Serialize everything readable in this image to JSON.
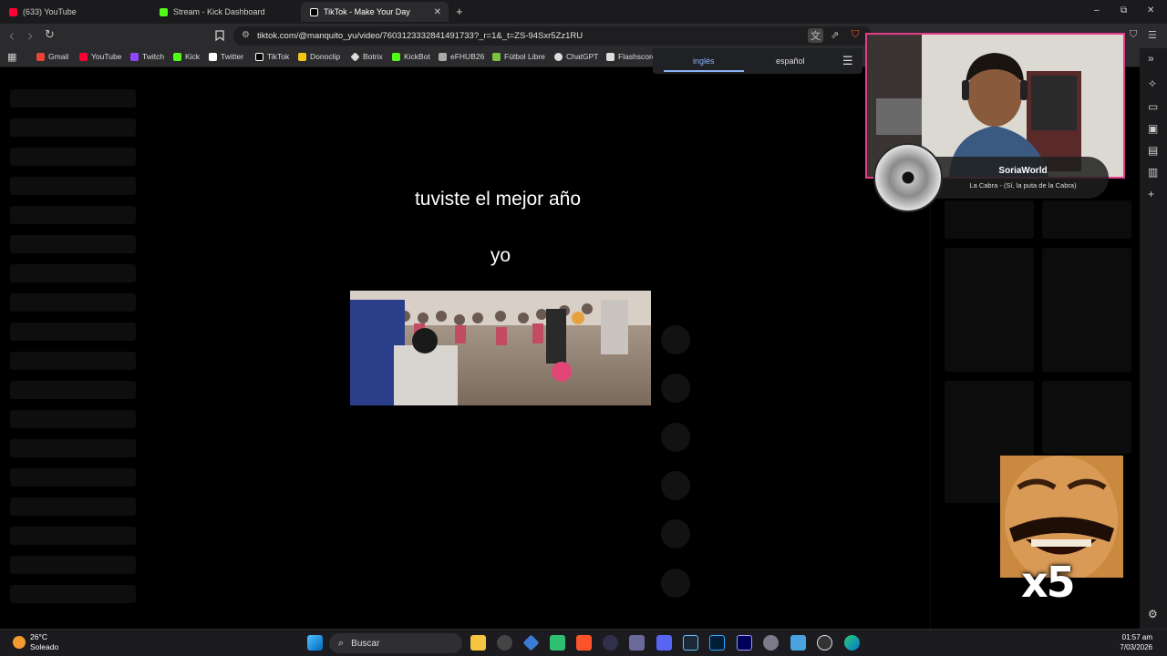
{
  "tabs": [
    {
      "title": "(633) YouTube",
      "color": "#ff0033",
      "active": false
    },
    {
      "title": "Stream - Kick Dashboard",
      "color": "#53fc18",
      "active": false
    },
    {
      "title": "TikTok - Make Your Day",
      "color": "#ffffff",
      "active": true
    }
  ],
  "tab_close": "✕",
  "new_tab": "+",
  "window_controls": {
    "minimize": "–",
    "restore": "⧉",
    "close": "✕"
  },
  "nav": {
    "back": "‹",
    "forward": "›",
    "reload": "↻",
    "bookmark_icon": "bookmark-icon"
  },
  "url": "tiktok.com/@manquito_yu/video/7603123332841491733?_r=1&_t=ZS-94Sxr5Zz1RU",
  "bookmarks": [
    {
      "label": "Gmail",
      "color": "#ea4335"
    },
    {
      "label": "YouTube",
      "color": "#ff0033"
    },
    {
      "label": "Twitch",
      "color": "#9146ff"
    },
    {
      "label": "Kick",
      "color": "#53fc18"
    },
    {
      "label": "Twitter",
      "color": "#ffffff"
    },
    {
      "label": "TikTok",
      "color": "#ffffff"
    },
    {
      "label": "Donoclip",
      "color": "#f5c518"
    },
    {
      "label": "Botrix",
      "color": "#dddddd"
    },
    {
      "label": "KickBot",
      "color": "#53fc18"
    },
    {
      "label": "eFHUB26",
      "color": "#aaaaaa"
    },
    {
      "label": "Fútbol Libre",
      "color": "#7cc242"
    },
    {
      "label": "ChatGPT",
      "color": "#dddddd"
    },
    {
      "label": "Flashscore",
      "color": "#dddddd"
    }
  ],
  "translate": {
    "source": "inglés",
    "target": "español",
    "menu": "☰"
  },
  "video": {
    "caption_top": "tuviste el mejor año",
    "caption_bottom": "yo"
  },
  "now_playing": {
    "title": "SoriaWorld",
    "subtitle": "La Cabra - (Sí, la puta de la Cabra)"
  },
  "overlay": {
    "multiplier": "x5"
  },
  "taskbar": {
    "weather_temp": "26°C",
    "weather_desc": "Soleado",
    "search_label": "Buscar",
    "time": "01:57 am",
    "date": "7/03/2026"
  },
  "accent": "#e33c8b"
}
